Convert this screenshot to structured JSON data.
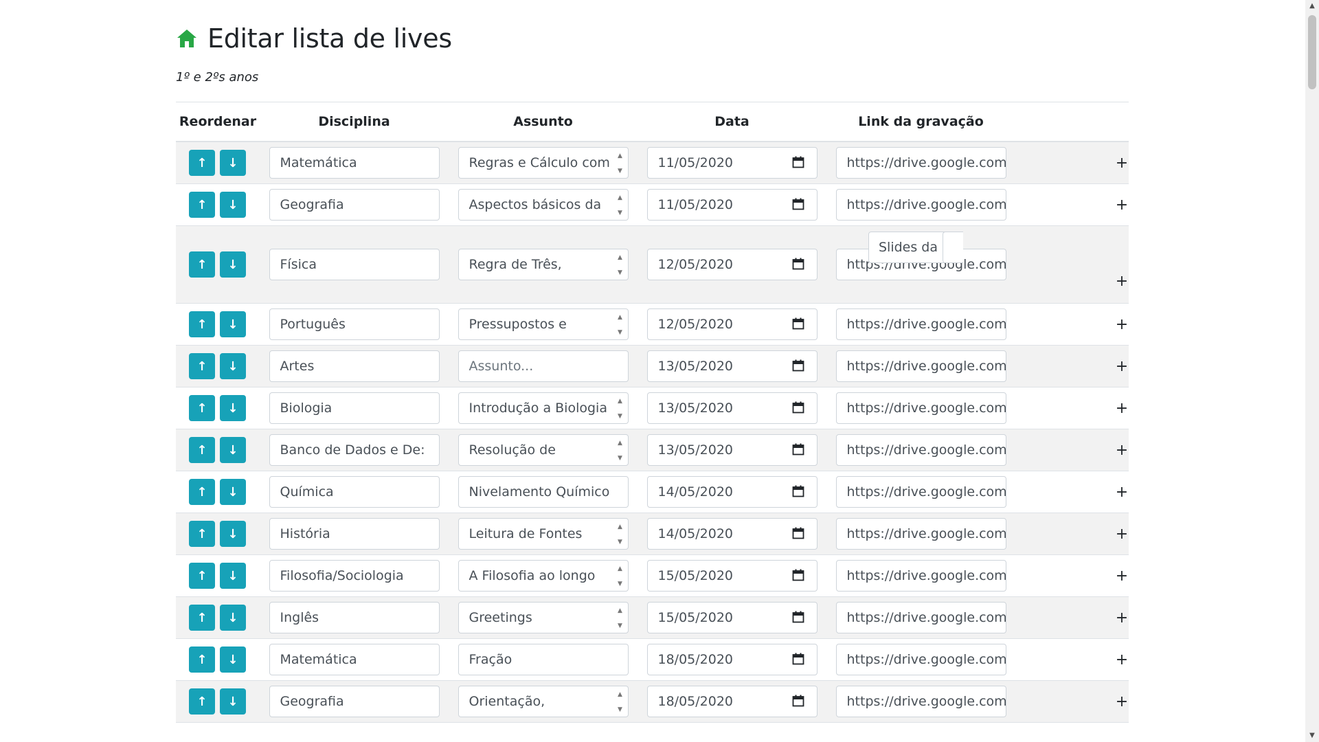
{
  "header": {
    "title": "Editar lista de lives",
    "subtitle": "1º e 2ºs anos"
  },
  "colors": {
    "accent": "#17a2b8",
    "home": "#28a745"
  },
  "table": {
    "headers": {
      "reorder": "Reordenar",
      "disciplina": "Disciplina",
      "assunto": "Assunto",
      "data": "Data",
      "link": "Link da gravação"
    },
    "rows": [
      {
        "disciplina": "Matemática",
        "assunto": "Regras e Cálculo com",
        "data": "11/05/2020",
        "link": "https://drive.google.com"
      },
      {
        "disciplina": "Geografia",
        "assunto": "Aspectos básicos da",
        "data": "11/05/2020",
        "link": "https://drive.google.com"
      },
      {
        "disciplina": "Física",
        "assunto": "Regra de Três,",
        "data": "12/05/2020",
        "link": "https://drive.google.com",
        "slides": "Slides da a"
      },
      {
        "disciplina": "Português",
        "assunto": "Pressupostos e",
        "data": "12/05/2020",
        "link": "https://drive.google.com"
      },
      {
        "disciplina": "Artes",
        "assunto": "",
        "data": "13/05/2020",
        "link": "https://drive.google.com"
      },
      {
        "disciplina": "Biologia",
        "assunto": "Introdução a Biologia",
        "data": "13/05/2020",
        "link": "https://drive.google.com"
      },
      {
        "disciplina": "Banco de Dados e De:",
        "assunto": "Resolução de",
        "data": "13/05/2020",
        "link": "https://drive.google.com"
      },
      {
        "disciplina": "Química",
        "assunto": "Nivelamento Químico",
        "data": "14/05/2020",
        "link": "https://drive.google.com"
      },
      {
        "disciplina": "História",
        "assunto": "Leitura de Fontes",
        "data": "14/05/2020",
        "link": "https://drive.google.com"
      },
      {
        "disciplina": "Filosofia/Sociologia",
        "assunto": "A Filosofia ao longo",
        "data": "15/05/2020",
        "link": "https://drive.google.com"
      },
      {
        "disciplina": "Inglês",
        "assunto": "Greetings",
        "data": "15/05/2020",
        "link": "https://drive.google.com"
      },
      {
        "disciplina": "Matemática",
        "assunto": "Fração",
        "data": "18/05/2020",
        "link": "https://drive.google.com"
      },
      {
        "disciplina": "Geografia",
        "assunto": "Orientação,",
        "data": "18/05/2020",
        "link": "https://drive.google.com"
      }
    ],
    "assunto_placeholder": "Assunto...",
    "plus_label": "+"
  }
}
